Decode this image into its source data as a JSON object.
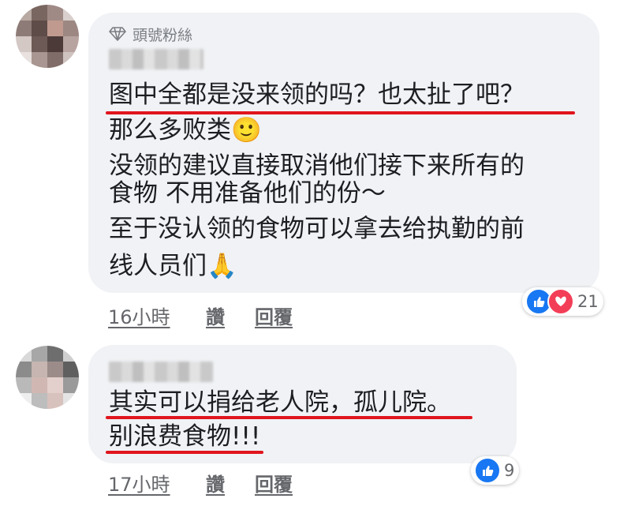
{
  "comments": [
    {
      "badge": "頭號粉絲",
      "lines": [
        "图中全都是没来领的吗？也太扯了吧？",
        "那么多败类🙂",
        "没领的建议直接取消他们接下来所有的",
        "食物 不用准备他们的份～",
        "至于没认领的食物可以拿去给执勤的前",
        "线人员们🙏"
      ],
      "time": "16小時",
      "like_label": "讚",
      "reply_label": "回覆",
      "reaction_count": "21",
      "reactions": [
        "like",
        "love"
      ]
    },
    {
      "lines": [
        "其实可以捐给老人院，孤儿院。",
        "别浪费食物!!!"
      ],
      "time": "17小時",
      "like_label": "讚",
      "reply_label": "回覆",
      "reaction_count": "9",
      "reactions": [
        "like"
      ]
    }
  ],
  "colors": {
    "bubble": "#f0f2f5",
    "underline": "#e0151d",
    "like": "#1877f2",
    "love": "#f33e58"
  }
}
